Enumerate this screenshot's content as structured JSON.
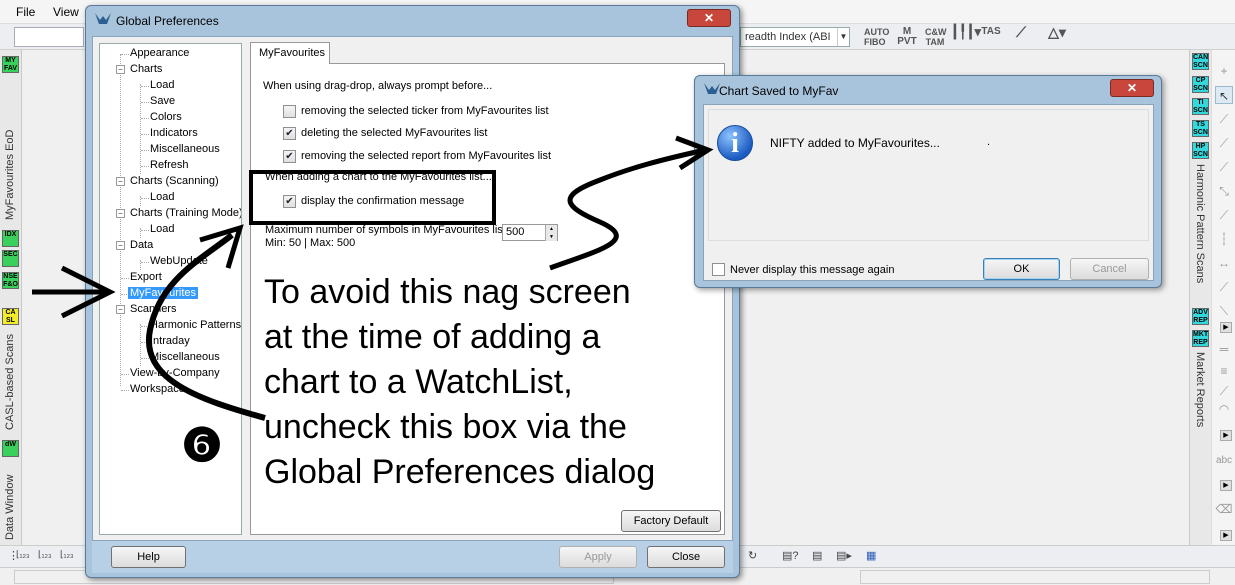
{
  "app": {
    "menu": [
      "File",
      "View"
    ],
    "breadth_combo": "readth Index (ABI",
    "toolbar_icons": [
      "AUTO FIBO",
      "M PVT",
      "C&W TAM",
      "candle-icon",
      "TAS",
      "trend-icon",
      "pattern-icon"
    ],
    "left_panels": [
      {
        "label": "MyFavourites EoD",
        "square": "MY FAV"
      },
      {
        "label": "CASL-based Scans",
        "square": "CA SL"
      },
      {
        "label": "Data Window",
        "square": "dW"
      }
    ],
    "left_squares": [
      "IDX",
      "SEC",
      "NSE F&O"
    ],
    "right_squares": [
      "CAN SCN",
      "CP SCN",
      "TI SCN",
      "TS SCN",
      "HP SCN",
      "ADV REP",
      "MKT REP"
    ],
    "right_panels": [
      "Harmonic Pattern Scans",
      "Market Reports"
    ],
    "right_tool_text": "abc"
  },
  "global_prefs": {
    "title": "Global Preferences",
    "close": "✕",
    "tree": [
      {
        "label": "Appearance",
        "level": 0
      },
      {
        "label": "Charts",
        "level": 0,
        "expander": "−"
      },
      {
        "label": "Load",
        "level": 1
      },
      {
        "label": "Save",
        "level": 1
      },
      {
        "label": "Colors",
        "level": 1
      },
      {
        "label": "Indicators",
        "level": 1
      },
      {
        "label": "Miscellaneous",
        "level": 1
      },
      {
        "label": "Refresh",
        "level": 1
      },
      {
        "label": "Charts (Scanning)",
        "level": 0,
        "expander": "−"
      },
      {
        "label": "Load",
        "level": 1
      },
      {
        "label": "Charts (Training Mode)",
        "level": 0,
        "expander": "−"
      },
      {
        "label": "Load",
        "level": 1
      },
      {
        "label": "Data",
        "level": 0,
        "expander": "−"
      },
      {
        "label": "WebUpdate",
        "level": 1
      },
      {
        "label": "Export",
        "level": 0
      },
      {
        "label": "MyFavourites",
        "level": 0,
        "selected": true
      },
      {
        "label": "Scanners",
        "level": 0,
        "expander": "−"
      },
      {
        "label": "Harmonic Patterns",
        "level": 1
      },
      {
        "label": "Intraday",
        "level": 1
      },
      {
        "label": "Miscellaneous",
        "level": 1
      },
      {
        "label": "View-by-Company",
        "level": 0
      },
      {
        "label": "Workspace",
        "level": 0
      }
    ],
    "tab": "MyFavourites",
    "drag_drop_label": "When using drag-drop, always prompt before...",
    "options": [
      {
        "label": "removing the selected ticker from MyFavourites list",
        "checked": false
      },
      {
        "label": "deleting the selected MyFavourites list",
        "checked": true
      },
      {
        "label": "removing the selected report from MyFavourites list",
        "checked": true
      }
    ],
    "adding_label": "When adding a chart to the MyFavourites list...",
    "confirm_option": {
      "label": "display the confirmation message",
      "checked": true
    },
    "max_label": "Maximum number of symbols in MyFavourites list",
    "max_range": "Min: 50  |  Max: 500",
    "max_value": "500",
    "factory_default": "Factory Default",
    "help": "Help",
    "apply": "Apply",
    "close_btn": "Close"
  },
  "chart_saved": {
    "title": "Chart Saved to MyFav",
    "close": "✕",
    "info_glyph": "i",
    "message": "NIFTY added to MyFavourites...",
    "message_dot": ".",
    "never_label": "Never display this message again",
    "ok": "OK",
    "cancel": "Cancel"
  },
  "annotation": {
    "lines": [
      "To avoid this nag screen",
      "at the time of adding a",
      "chart to a WatchList,",
      "uncheck this box via the",
      "Global Preferences dialog"
    ],
    "step_number": "❻"
  }
}
